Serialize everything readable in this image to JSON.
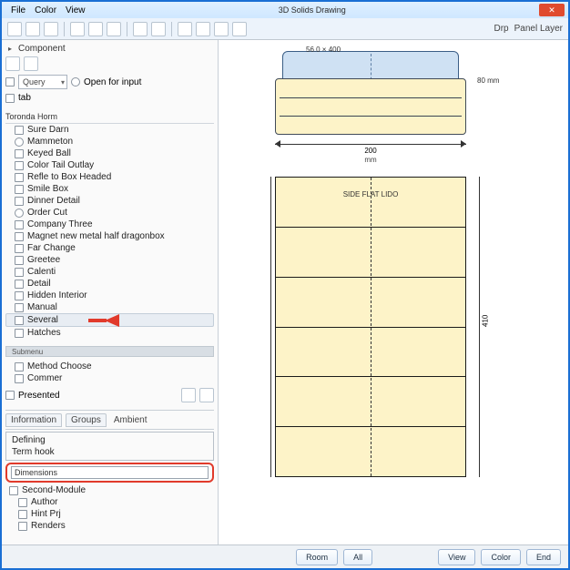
{
  "menu": {
    "m1": "File",
    "m2": "Color",
    "m3": "View"
  },
  "title": "3D Solids Drawing",
  "toolbar_right": {
    "r1": "Drp",
    "r2": "Panel Layer"
  },
  "side": {
    "header": "Component",
    "query_label": "Query",
    "query_hint": "Open for input",
    "dim_tab": "tab",
    "cat1": "Toronda Horm",
    "items1": [
      "Sure Darn",
      "Mammeton",
      "Keyed Ball",
      "Color Tail Outlay",
      "Refle to Box Headed",
      "Smile Box",
      "Dinner Detail",
      "Order Cut",
      "Company Three",
      "Magnet new metal half dragonbox",
      "Far Change",
      "Greetee",
      "Calenti",
      "Detail",
      "Hidden Interior",
      "Manual",
      "Several",
      "Hatches"
    ],
    "sub1": "Submenu",
    "sub_items": [
      "Method Choose",
      "Commer"
    ],
    "panel_label": "Presented",
    "tabs": {
      "t1": "Information",
      "t2": "Groups",
      "t3": "Ambient"
    },
    "p2": {
      "h1": "Defining",
      "h2": "Term hook",
      "input": "Dimensions",
      "h3": "Second-Module",
      "list": [
        "Author",
        "Hint Prj",
        "Renders"
      ]
    }
  },
  "diagram": {
    "top_dim": "56.0 × 400",
    "side_dim": "80 mm",
    "width_dim": "200",
    "width_unit": "mm",
    "sheet_hdr": "SIDE FLAT LIDO",
    "vert_dim": "410"
  },
  "footer": {
    "b1": "Room",
    "b2": "All",
    "b3": "View",
    "b4": "Color",
    "b5": "End"
  }
}
